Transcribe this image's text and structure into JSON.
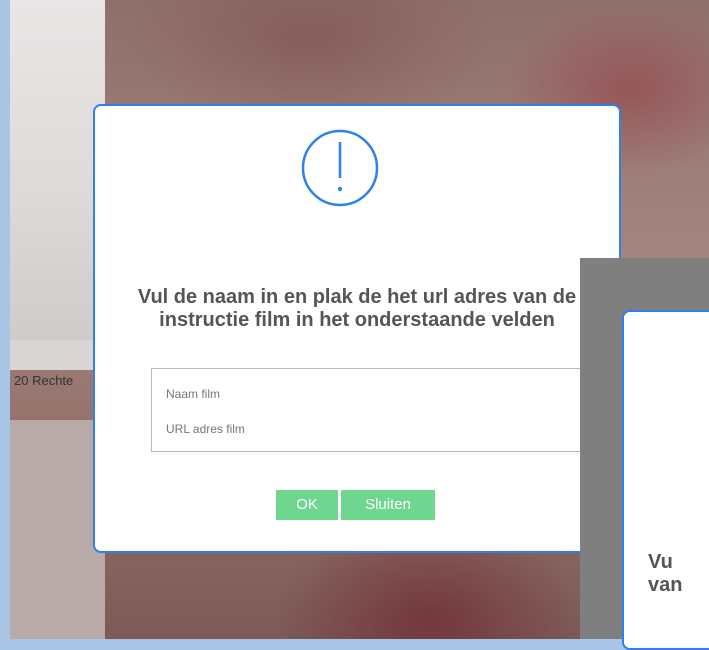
{
  "background": {
    "label": "20  Rechte"
  },
  "dialog": {
    "icon": "alert-circle-icon",
    "title": "Vul de naam in en plak de het url adres van de instructie film in het onderstaande velden",
    "fields": {
      "name_placeholder": "Naam film",
      "url_placeholder": "URL adres film"
    },
    "buttons": {
      "ok": "OK",
      "close": "Sluiten"
    },
    "accent_color": "#2f80ed",
    "button_color": "#6fd68f"
  },
  "dialog2": {
    "line1": "Vu",
    "line2": "van"
  }
}
